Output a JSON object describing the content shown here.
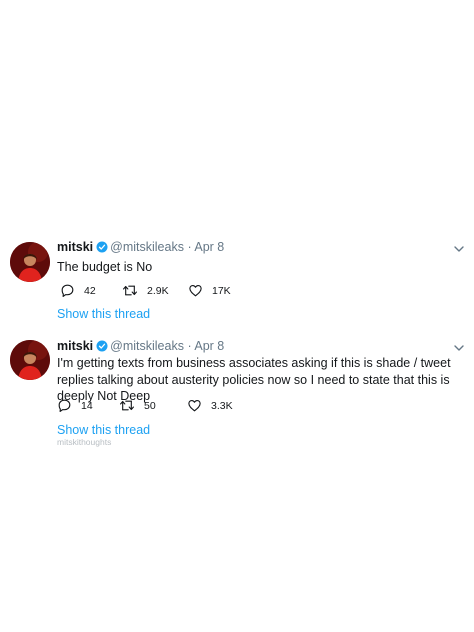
{
  "tweets": [
    {
      "name": "mitski",
      "handle": "@mitskileaks",
      "date": "· Apr 8",
      "text": "The budget is No",
      "replies": "42",
      "retweets": "2.9K",
      "likes": "17K",
      "thread_link": "Show this thread"
    },
    {
      "name": "mitski",
      "handle": "@mitskileaks",
      "date": "· Apr 8",
      "text": "I'm getting texts from business associates asking if this is shade / tweet replies talking about austerity policies now so I need to state that this is deeply Not Deep",
      "replies": "14",
      "retweets": "50",
      "likes": "3.3K",
      "thread_link": "Show this thread"
    }
  ],
  "watermark": "mitskithoughts",
  "colors": {
    "link": "#1da1f2",
    "verified": "#1da1f2",
    "muted": "#657786"
  }
}
